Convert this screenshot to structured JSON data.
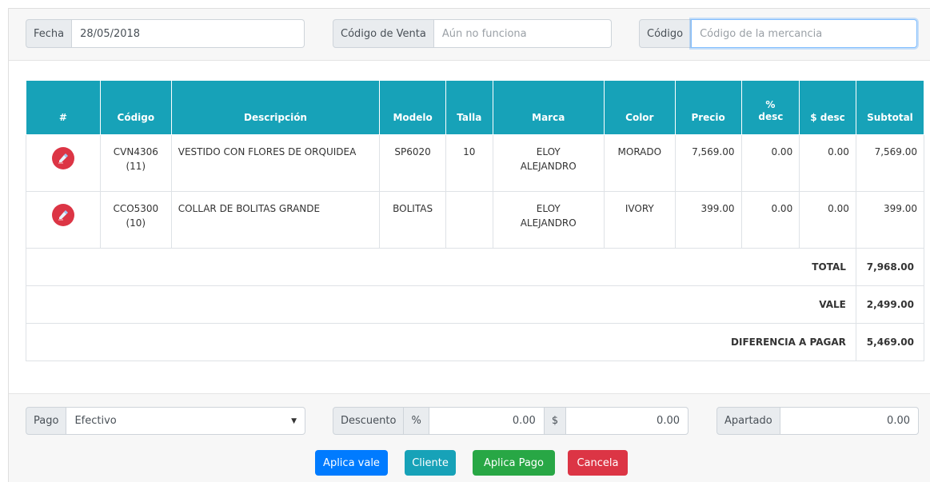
{
  "header": {
    "fecha_label": "Fecha",
    "fecha_value": "28/05/2018",
    "codigo_venta_label": "Código de Venta",
    "codigo_venta_placeholder": "Aún no funciona",
    "codigo_label": "Código",
    "codigo_placeholder": "Código de la mercancia"
  },
  "table": {
    "columns": [
      "#",
      "Código",
      "Descripción",
      "Modelo",
      "Talla",
      "Marca",
      "Color",
      "Precio",
      "% desc",
      "$ desc",
      "Subtotal"
    ],
    "rows": [
      {
        "codigo": "CVN4306",
        "codigo_qty": "(11)",
        "descripcion": "VESTIDO CON FLORES DE ORQUIDEA",
        "modelo": "SP6020",
        "talla": "10",
        "marca": "ELOY ALEJANDRO",
        "color": "MORADO",
        "precio": "7,569.00",
        "pct_desc": "0.00",
        "amt_desc": "0.00",
        "subtotal": "7,569.00"
      },
      {
        "codigo": "CCO5300",
        "codigo_qty": "(10)",
        "descripcion": "COLLAR DE BOLITAS GRANDE",
        "modelo": "BOLITAS",
        "talla": "",
        "marca": "ELOY ALEJANDRO",
        "color": "IVORY",
        "precio": "399.00",
        "pct_desc": "0.00",
        "amt_desc": "0.00",
        "subtotal": "399.00"
      }
    ],
    "total_label": "TOTAL",
    "total_value": "7,968.00",
    "vale_label": "VALE",
    "vale_value": "2,499.00",
    "diferencia_label": "DIFERENCIA A PAGAR",
    "diferencia_value": "5,469.00"
  },
  "footer": {
    "pago_label": "Pago",
    "pago_value": "Efectivo",
    "descuento_label": "Descuento",
    "pct_symbol": "%",
    "pct_value": "0.00",
    "dollar_symbol": "$",
    "dollar_value": "0.00",
    "apartado_label": "Apartado",
    "apartado_value": "0.00"
  },
  "buttons": {
    "aplica_vale": "Aplica vale",
    "cliente": "Cliente",
    "aplica_pago": "Aplica Pago",
    "cancela": "Cancela"
  },
  "colors": {
    "header_teal": "#17a2b8",
    "primary": "#007bff",
    "success": "#28a745",
    "danger": "#dc3545",
    "alert_text": "#e31b1b"
  }
}
